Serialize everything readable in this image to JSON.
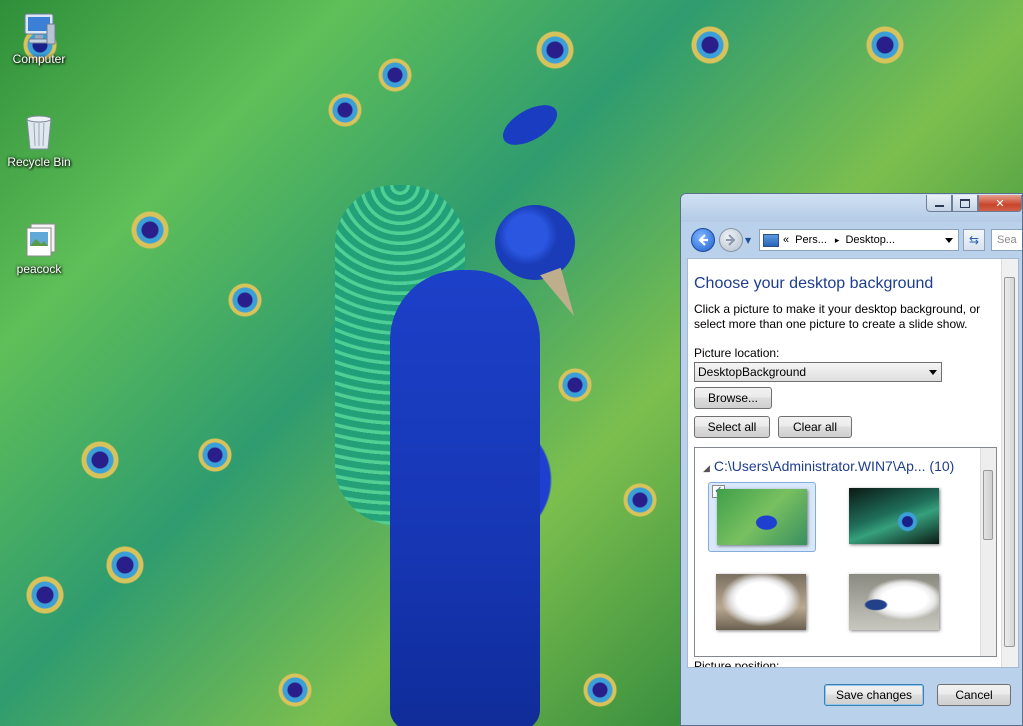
{
  "desktop": {
    "icons": [
      {
        "label": "Computer",
        "icon": "computer-icon"
      },
      {
        "label": "Recycle Bin",
        "icon": "recycle-bin-icon"
      },
      {
        "label": "peacock",
        "icon": "photo-file-icon"
      }
    ]
  },
  "window": {
    "controls": {
      "minimize": "–",
      "maximize": "□",
      "close": "✕"
    },
    "breadcrumb": {
      "prefix": "«",
      "part1": "Pers...",
      "separator": "▸",
      "part2": "Desktop..."
    },
    "search": {
      "placeholder": "Sea"
    },
    "heading": "Choose your desktop background",
    "description": "Click a picture to make it your desktop background, or select more than one picture to create a slide show.",
    "picture_location_label": "Picture location:",
    "picture_location_value": "DesktopBackground",
    "browse_button": "Browse...",
    "select_all_button": "Select all",
    "clear_all_button": "Clear all",
    "group_header": "C:\\Users\\Administrator.WIN7\\Ap... (10)",
    "picture_position_label": "Picture position:",
    "save_button": "Save changes",
    "cancel_button": "Cancel"
  },
  "colors": {
    "heading": "#1e3d8f",
    "window_frame": "#b9d1ea",
    "selection": "#d9e8fb"
  }
}
